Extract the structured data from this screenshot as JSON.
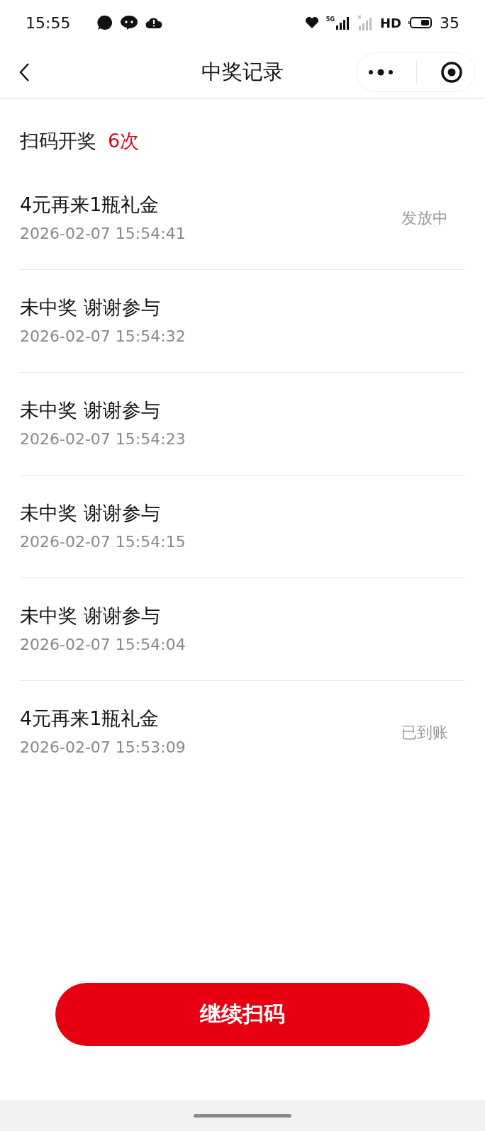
{
  "status_bar": {
    "time": "15:55",
    "network": "5G",
    "hd": "HD",
    "battery": "35"
  },
  "nav": {
    "title": "中奖记录"
  },
  "summary": {
    "label": "扫码开奖",
    "count": "6次"
  },
  "records": [
    {
      "title": "4元再来1瓶礼金",
      "time": "2026-02-07 15:54:41",
      "status": "发放中"
    },
    {
      "title": "未中奖 谢谢参与",
      "time": "2026-02-07 15:54:32"
    },
    {
      "title": "未中奖 谢谢参与",
      "time": "2026-02-07 15:54:23"
    },
    {
      "title": "未中奖 谢谢参与",
      "time": "2026-02-07 15:54:15"
    },
    {
      "title": "未中奖 谢谢参与",
      "time": "2026-02-07 15:54:04"
    },
    {
      "title": "4元再来1瓶礼金",
      "time": "2026-02-07 15:53:09",
      "status": "已到账"
    }
  ],
  "button": {
    "label": "继续扫码"
  }
}
